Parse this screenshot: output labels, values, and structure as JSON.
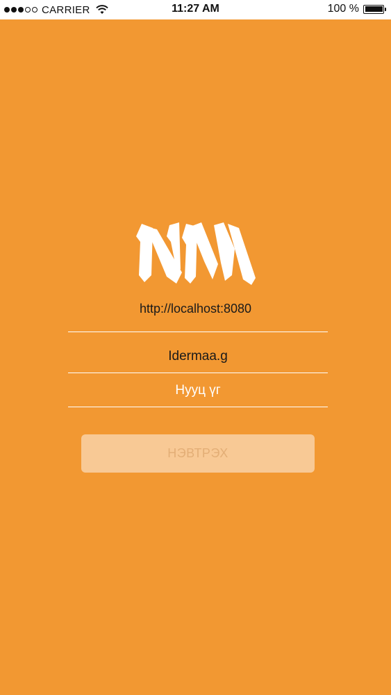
{
  "status_bar": {
    "carrier": "CARRIER",
    "time": "11:27 AM",
    "battery": "100 %",
    "signal_bars_filled": 3,
    "signal_bars_total": 5
  },
  "login": {
    "server_url": "http://localhost:8080",
    "username_value": "Idermaa.g",
    "password_placeholder": "Нууц үг",
    "login_button_label": "НЭВТРЭХ"
  },
  "colors": {
    "background": "#F29832",
    "button_bg": "#F8C995",
    "button_text": "#E3AE76",
    "field_line": "#FFFFFF"
  },
  "icons": {
    "wifi": "wifi-icon",
    "battery": "battery-icon",
    "logo": "nm-logo"
  }
}
